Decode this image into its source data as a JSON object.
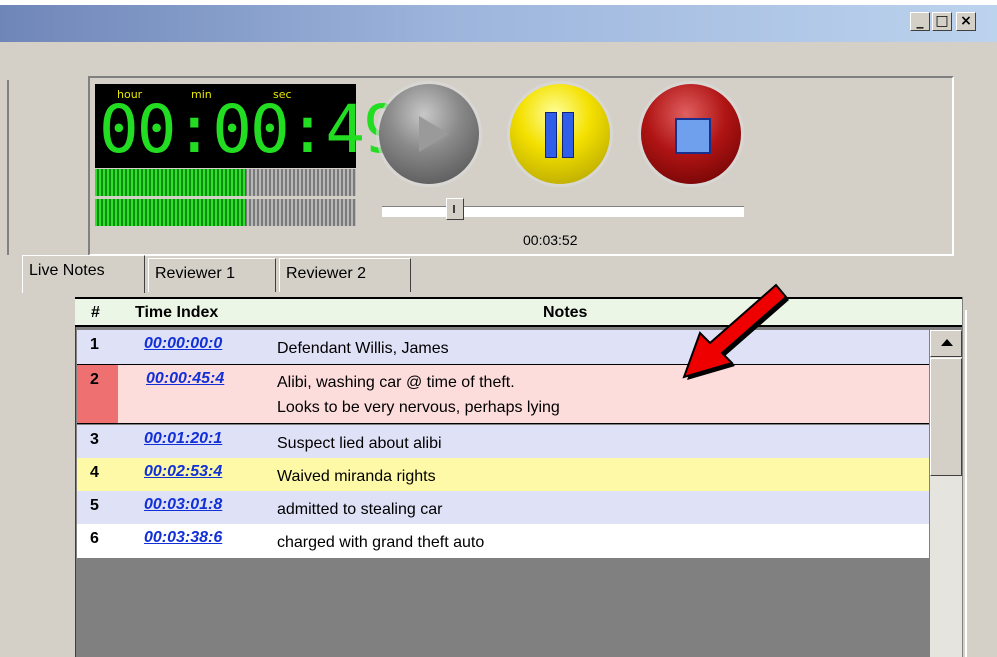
{
  "window": {
    "controls": {
      "minimize": "_",
      "maximize": "□",
      "close": "×"
    }
  },
  "player": {
    "lcd_labels": {
      "hour": "hour",
      "min": "min",
      "sec": "sec"
    },
    "elapsed": "00:00:49.4",
    "meter_levels": [
      0.58,
      0.58
    ],
    "buttons": [
      "play",
      "pause",
      "stop"
    ],
    "position_time": "00:03:52",
    "slider_value": 0.18,
    "colors": {
      "lcd_digits": "#22dd22",
      "lcd_labels": "#e8e800",
      "play": "#8a8a8a",
      "pause": "#f4e000",
      "stop": "#b01414"
    }
  },
  "tabs": [
    {
      "label": "Live Notes",
      "active": true
    },
    {
      "label": "Reviewer 1",
      "active": false
    },
    {
      "label": "Reviewer 2",
      "active": false
    }
  ],
  "grid": {
    "columns": {
      "num": "#",
      "time": "Time Index",
      "notes": "Notes"
    },
    "rows": [
      {
        "num": "1",
        "time": "00:00:00:0",
        "notes": [
          "Defendant  Willis, James"
        ],
        "color": "#dfe1f7"
      },
      {
        "num": "2",
        "time": "00:00:45:4",
        "notes": [
          "Alibi, washing car @ time of theft.",
          "Looks to be very nervous, perhaps lying"
        ],
        "color": "#fddcdc",
        "selected": true
      },
      {
        "num": "3",
        "time": "00:01:20:1",
        "notes": [
          "Suspect lied about alibi"
        ],
        "color": "#dfe1f7"
      },
      {
        "num": "4",
        "time": "00:02:53:4",
        "notes": [
          "Waived miranda rights"
        ],
        "color": "#fdf9a6"
      },
      {
        "num": "5",
        "time": "00:03:01:8",
        "notes": [
          "admitted to stealing car"
        ],
        "color": "#dfe1f7"
      },
      {
        "num": "6",
        "time": "00:03:38:6",
        "notes": [
          "charged with grand theft auto"
        ],
        "color": "#ffffff"
      }
    ],
    "link_color": "#1230d8"
  },
  "annotation": {
    "arrow_color": "#ee0000"
  }
}
